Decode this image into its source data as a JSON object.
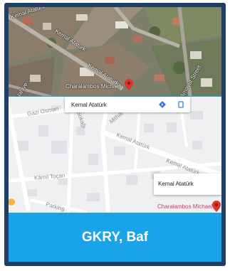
{
  "satellite": {
    "streets": [
      "Kemal Atatürk",
      "Kemal Atatürk",
      "Kemal Atatürk",
      "Arnavut Street",
      "Nahiye"
    ],
    "poi": "Charalambos Michael"
  },
  "street_map": {
    "streets": [
      "Gazi Osman",
      "Mithat Paşa",
      "Kemal Atatürk",
      "Kemal Atatürk",
      "Kâmil Toçan",
      "Parking",
      "Sokağı"
    ],
    "poi": "Charalambos Michael"
  },
  "tooltip_top": {
    "text": "Kemal Atatürk"
  },
  "tooltip_right": {
    "text": "Kemal Atatürk"
  },
  "caption": "GKRY, Baf",
  "colors": {
    "frame": "#1f3f66",
    "caption_bg": "#1aa3e8",
    "pin": "#e0312b",
    "poi_text": "#d23b6b"
  }
}
